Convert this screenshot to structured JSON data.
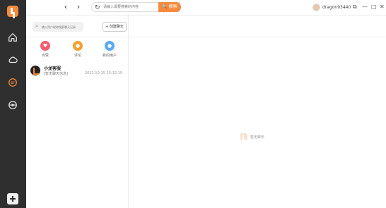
{
  "colors": {
    "accent": "#f58a3c",
    "sidebar": "#2f2f2f",
    "fav": "#f35e70",
    "review": "#f5a131",
    "discover": "#5aaaf2"
  },
  "topbar": {
    "back_icon": "‹",
    "forward_icon": "›",
    "refresh_icon": "↻",
    "search_placeholder": "请输入需要搜索的内容",
    "search_button": "🔍 搜索",
    "username": "dragon93440",
    "window_controls": {
      "restore": "⧉",
      "minimize": "—",
      "maximize": "□",
      "close": "✕"
    }
  },
  "chatlist": {
    "search_placeholder": "输入用户昵称搜索聊天记录",
    "new_chat_label": "+ 创建聊天",
    "quick_actions": [
      {
        "label": "点赞",
        "icon": "heart-icon"
      },
      {
        "label": "评论",
        "icon": "comment-icon"
      },
      {
        "label": "新的用户",
        "icon": "user-icon"
      }
    ],
    "conversations": [
      {
        "name": "小龙客服",
        "preview": "[暂无聊天信息]",
        "time": "2021-10-15 15:32:19"
      }
    ]
  },
  "main": {
    "empty_text": "暂无聊天"
  }
}
